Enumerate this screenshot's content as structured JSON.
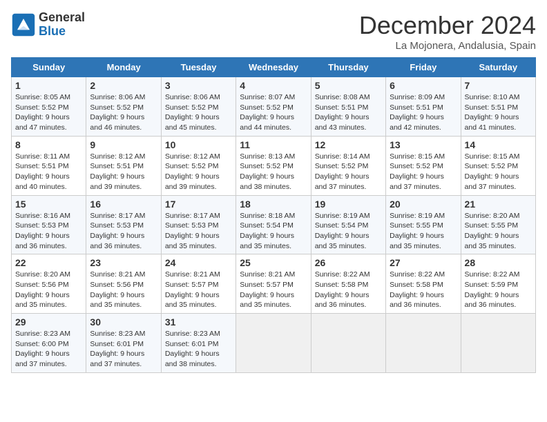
{
  "header": {
    "logo_line1": "General",
    "logo_line2": "Blue",
    "month": "December 2024",
    "location": "La Mojonera, Andalusia, Spain"
  },
  "weekdays": [
    "Sunday",
    "Monday",
    "Tuesday",
    "Wednesday",
    "Thursday",
    "Friday",
    "Saturday"
  ],
  "weeks": [
    [
      {
        "day": "1",
        "sunrise": "8:05 AM",
        "sunset": "5:52 PM",
        "daylight": "9 hours and 47 minutes."
      },
      {
        "day": "2",
        "sunrise": "8:06 AM",
        "sunset": "5:52 PM",
        "daylight": "9 hours and 46 minutes."
      },
      {
        "day": "3",
        "sunrise": "8:06 AM",
        "sunset": "5:52 PM",
        "daylight": "9 hours and 45 minutes."
      },
      {
        "day": "4",
        "sunrise": "8:07 AM",
        "sunset": "5:52 PM",
        "daylight": "9 hours and 44 minutes."
      },
      {
        "day": "5",
        "sunrise": "8:08 AM",
        "sunset": "5:51 PM",
        "daylight": "9 hours and 43 minutes."
      },
      {
        "day": "6",
        "sunrise": "8:09 AM",
        "sunset": "5:51 PM",
        "daylight": "9 hours and 42 minutes."
      },
      {
        "day": "7",
        "sunrise": "8:10 AM",
        "sunset": "5:51 PM",
        "daylight": "9 hours and 41 minutes."
      }
    ],
    [
      {
        "day": "8",
        "sunrise": "8:11 AM",
        "sunset": "5:51 PM",
        "daylight": "9 hours and 40 minutes."
      },
      {
        "day": "9",
        "sunrise": "8:12 AM",
        "sunset": "5:51 PM",
        "daylight": "9 hours and 39 minutes."
      },
      {
        "day": "10",
        "sunrise": "8:12 AM",
        "sunset": "5:52 PM",
        "daylight": "9 hours and 39 minutes."
      },
      {
        "day": "11",
        "sunrise": "8:13 AM",
        "sunset": "5:52 PM",
        "daylight": "9 hours and 38 minutes."
      },
      {
        "day": "12",
        "sunrise": "8:14 AM",
        "sunset": "5:52 PM",
        "daylight": "9 hours and 37 minutes."
      },
      {
        "day": "13",
        "sunrise": "8:15 AM",
        "sunset": "5:52 PM",
        "daylight": "9 hours and 37 minutes."
      },
      {
        "day": "14",
        "sunrise": "8:15 AM",
        "sunset": "5:52 PM",
        "daylight": "9 hours and 37 minutes."
      }
    ],
    [
      {
        "day": "15",
        "sunrise": "8:16 AM",
        "sunset": "5:53 PM",
        "daylight": "9 hours and 36 minutes."
      },
      {
        "day": "16",
        "sunrise": "8:17 AM",
        "sunset": "5:53 PM",
        "daylight": "9 hours and 36 minutes."
      },
      {
        "day": "17",
        "sunrise": "8:17 AM",
        "sunset": "5:53 PM",
        "daylight": "9 hours and 35 minutes."
      },
      {
        "day": "18",
        "sunrise": "8:18 AM",
        "sunset": "5:54 PM",
        "daylight": "9 hours and 35 minutes."
      },
      {
        "day": "19",
        "sunrise": "8:19 AM",
        "sunset": "5:54 PM",
        "daylight": "9 hours and 35 minutes."
      },
      {
        "day": "20",
        "sunrise": "8:19 AM",
        "sunset": "5:55 PM",
        "daylight": "9 hours and 35 minutes."
      },
      {
        "day": "21",
        "sunrise": "8:20 AM",
        "sunset": "5:55 PM",
        "daylight": "9 hours and 35 minutes."
      }
    ],
    [
      {
        "day": "22",
        "sunrise": "8:20 AM",
        "sunset": "5:56 PM",
        "daylight": "9 hours and 35 minutes."
      },
      {
        "day": "23",
        "sunrise": "8:21 AM",
        "sunset": "5:56 PM",
        "daylight": "9 hours and 35 minutes."
      },
      {
        "day": "24",
        "sunrise": "8:21 AM",
        "sunset": "5:57 PM",
        "daylight": "9 hours and 35 minutes."
      },
      {
        "day": "25",
        "sunrise": "8:21 AM",
        "sunset": "5:57 PM",
        "daylight": "9 hours and 35 minutes."
      },
      {
        "day": "26",
        "sunrise": "8:22 AM",
        "sunset": "5:58 PM",
        "daylight": "9 hours and 36 minutes."
      },
      {
        "day": "27",
        "sunrise": "8:22 AM",
        "sunset": "5:58 PM",
        "daylight": "9 hours and 36 minutes."
      },
      {
        "day": "28",
        "sunrise": "8:22 AM",
        "sunset": "5:59 PM",
        "daylight": "9 hours and 36 minutes."
      }
    ],
    [
      {
        "day": "29",
        "sunrise": "8:23 AM",
        "sunset": "6:00 PM",
        "daylight": "9 hours and 37 minutes."
      },
      {
        "day": "30",
        "sunrise": "8:23 AM",
        "sunset": "6:01 PM",
        "daylight": "9 hours and 37 minutes."
      },
      {
        "day": "31",
        "sunrise": "8:23 AM",
        "sunset": "6:01 PM",
        "daylight": "9 hours and 38 minutes."
      },
      null,
      null,
      null,
      null
    ]
  ]
}
